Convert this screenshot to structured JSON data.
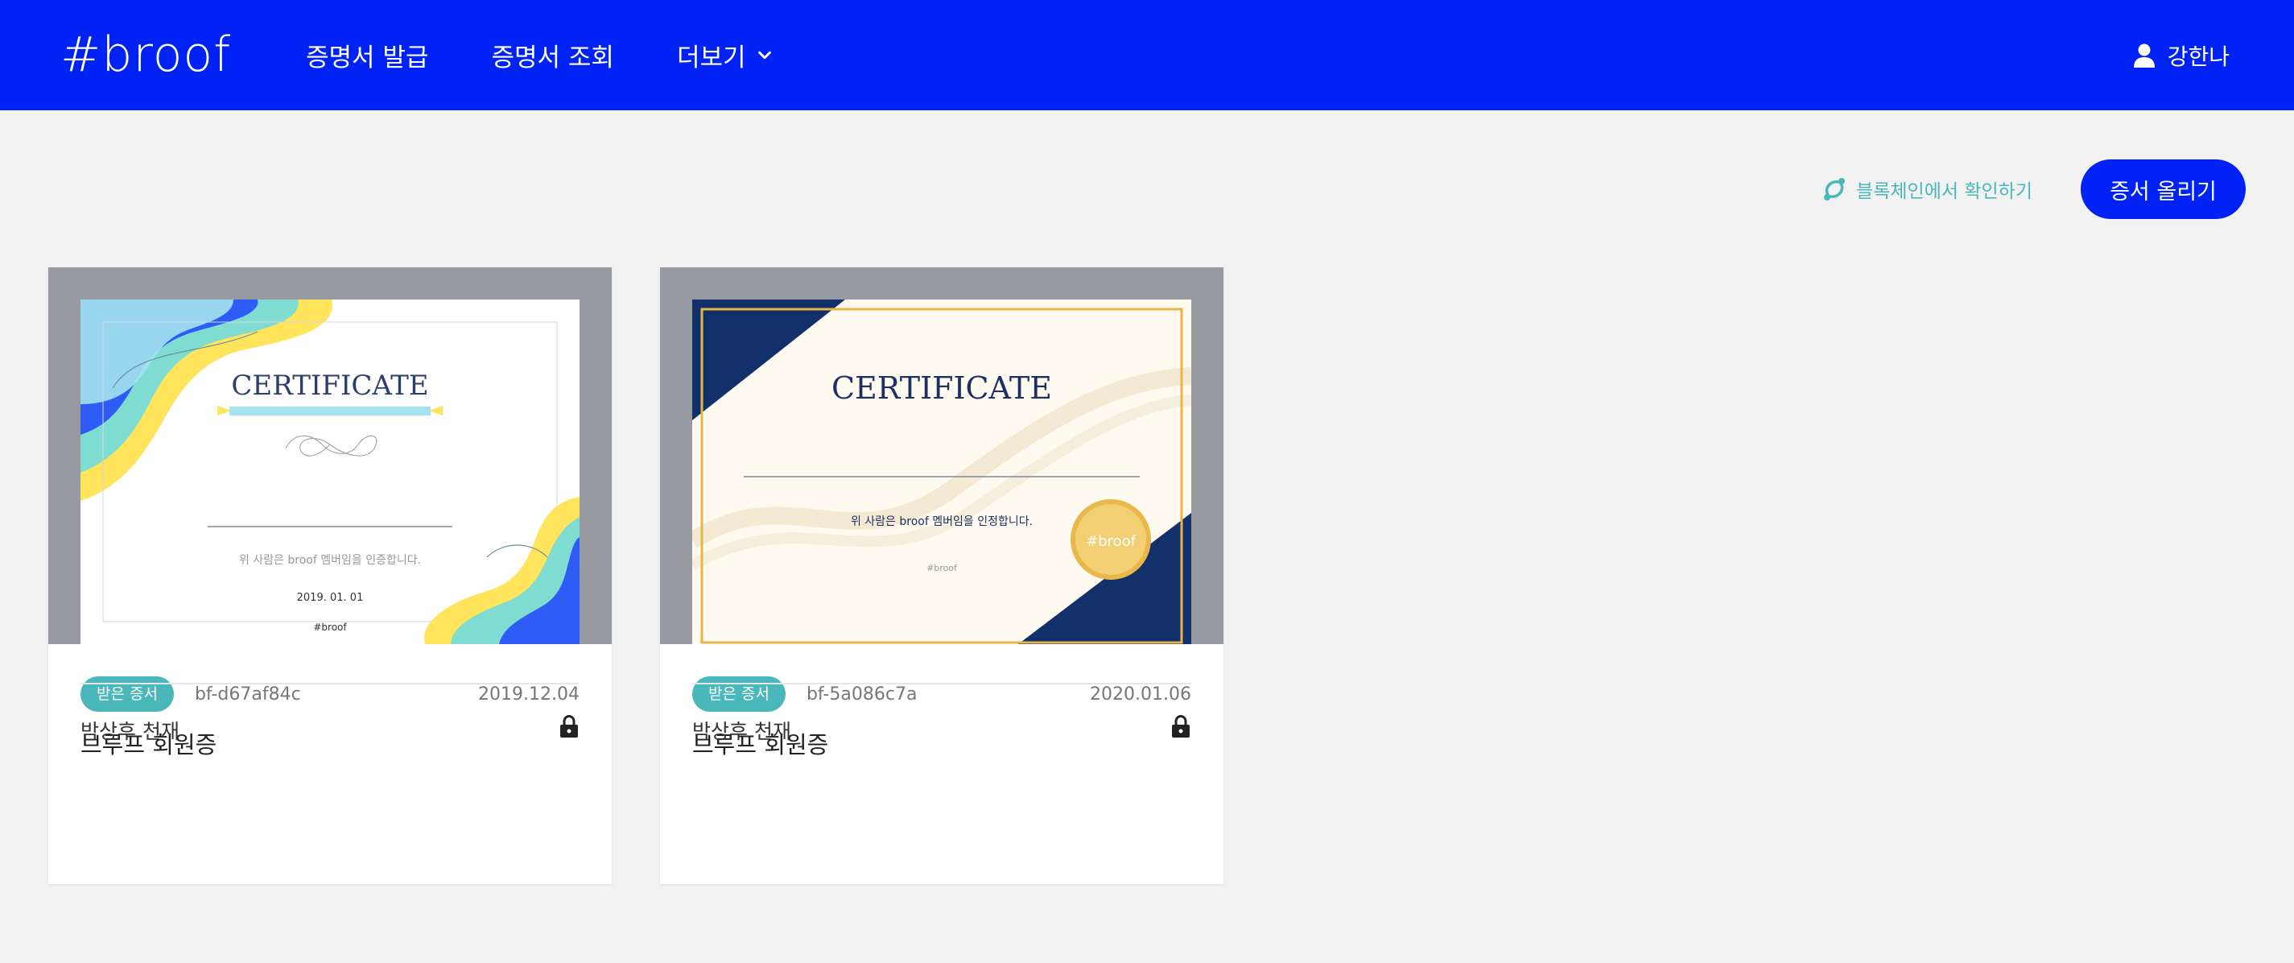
{
  "header": {
    "logo": "#broof",
    "nav": [
      {
        "label": "증명서 발급"
      },
      {
        "label": "증명서 조회"
      },
      {
        "label": "더보기"
      }
    ],
    "user_name": "강한나"
  },
  "toolbar": {
    "verify_label": "블록체인에서 확인하기",
    "upload_label": "증서 올리기"
  },
  "cards": [
    {
      "certificate": {
        "heading": "CERTIFICATE",
        "body": "위 사람은 broof 멤버임을 인증합니다.",
        "date": "2019. 01. 01",
        "footer": "#broof"
      },
      "badge": "받은 증서",
      "code": "bf-d67af84c",
      "date": "2019.12.04",
      "title": "브루프 회원증",
      "owner": "박상후 천재"
    },
    {
      "certificate": {
        "heading": "CERTIFICATE",
        "body": "위 사람은 broof 멤버임을 인정합니다.",
        "footer": "#broof",
        "seal": "#broof"
      },
      "badge": "받은 증서",
      "code": "bf-5a086c7a",
      "date": "2020.01.06",
      "title": "브루프 회원증",
      "owner": "박상후 천재"
    }
  ],
  "colors": {
    "primary": "#0022f5",
    "accent": "#4ab7ba",
    "background": "#f2f2f2",
    "thumb_frame": "#979aa1"
  },
  "icons": [
    "user-icon",
    "chevron-down-icon",
    "link-icon",
    "lock-icon",
    "seal-icon"
  ]
}
